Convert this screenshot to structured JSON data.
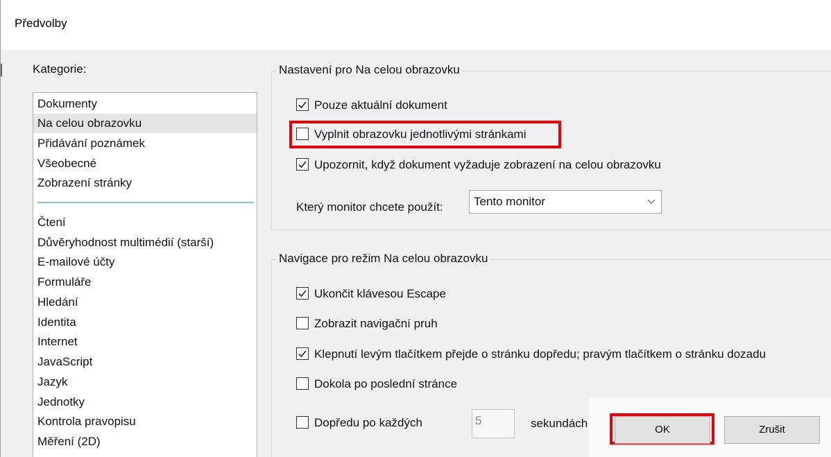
{
  "window": {
    "title": "Předvolby"
  },
  "categories": {
    "label": "Kategorie:",
    "top_items": [
      {
        "label": "Dokumenty",
        "selected": false
      },
      {
        "label": "Na celou obrazovku",
        "selected": true
      },
      {
        "label": "Přidávání poznámek",
        "selected": false
      },
      {
        "label": "Všeobecné",
        "selected": false
      },
      {
        "label": "Zobrazení stránky",
        "selected": false
      }
    ],
    "items": [
      {
        "label": "Čtení"
      },
      {
        "label": "Důvěryhodnost multimédií (starší)"
      },
      {
        "label": "E-mailové účty"
      },
      {
        "label": "Formuláře"
      },
      {
        "label": "Hledání"
      },
      {
        "label": "Identita"
      },
      {
        "label": "Internet"
      },
      {
        "label": "JavaScript"
      },
      {
        "label": "Jazyk"
      },
      {
        "label": "Jednotky"
      },
      {
        "label": "Kontrola pravopisu"
      },
      {
        "label": "Měření (2D)"
      }
    ]
  },
  "fullscreen_settings": {
    "title": "Nastavení pro Na celou obrazovku",
    "checkboxes": [
      {
        "label": "Pouze aktuální dokument",
        "checked": true
      },
      {
        "label": "Vyplnit obrazovku jednotlivými stránkami",
        "checked": false
      },
      {
        "label": "Upozornit, když dokument vyžaduje zobrazení na celou obrazovku",
        "checked": true
      }
    ],
    "monitor_label": "Který monitor chcete použít:",
    "monitor_value": "Tento monitor"
  },
  "navigation": {
    "title": "Navigace pro režim Na celou obrazovku",
    "checkboxes": [
      {
        "label": "Ukončit klávesou Escape",
        "checked": true
      },
      {
        "label": "Zobrazit navigační pruh",
        "checked": false
      },
      {
        "label": "Klepnutí levým tlačítkem přejde o stránku dopředu; pravým tlačítkem o stránku dozadu",
        "checked": true
      },
      {
        "label": "Dokola po poslední stránce",
        "checked": false
      },
      {
        "label": "Dopředu po každých",
        "checked": false
      }
    ],
    "interval_value": "5",
    "interval_unit": "sekundách"
  },
  "buttons": {
    "ok": "OK",
    "cancel": "Zrušit"
  },
  "colors": {
    "highlight": "#e8000b",
    "separator": "#86bfe3"
  }
}
